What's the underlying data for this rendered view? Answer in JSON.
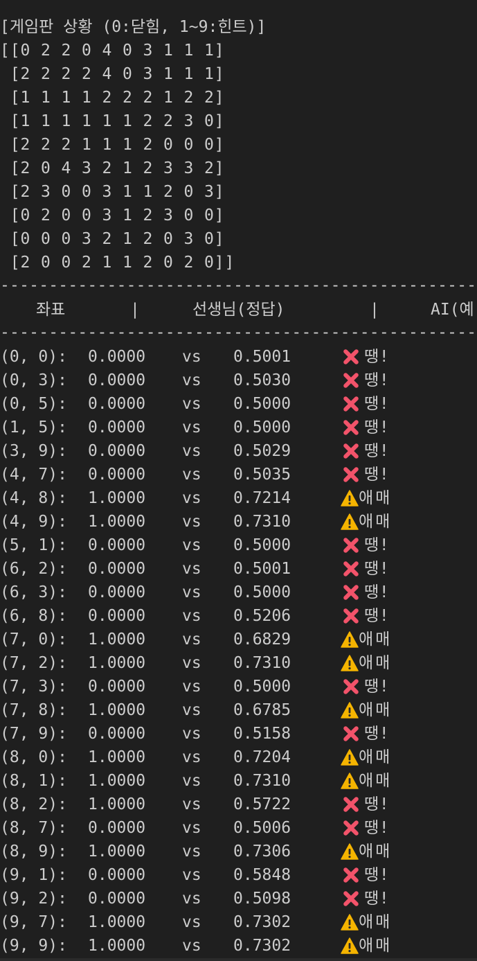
{
  "board_title": "[게임판 상황 (0:닫힘, 1~9:힌트)]",
  "board_rows": [
    "[[0 2 2 0 4 0 3 1 1 1]",
    " [2 2 2 2 4 0 3 1 1 1]",
    " [1 1 1 1 2 2 2 1 2 2]",
    " [1 1 1 1 1 1 2 2 3 0]",
    " [2 2 2 1 1 1 2 0 0 0]",
    " [2 0 4 3 2 1 2 3 3 2]",
    " [2 3 0 0 3 1 1 2 0 3]",
    " [0 2 0 0 3 1 2 3 0 0]",
    " [0 0 0 3 2 1 2 0 3 0]",
    " [2 0 0 2 1 1 2 0 2 0]]"
  ],
  "divider_short": "------------------------------------------------------------",
  "divider_long": "------------------------------------------------------------------------------------------------------",
  "table_header": {
    "coord": "좌표",
    "sep1": "|",
    "teacher": "선생님(정답)",
    "sep2": "|",
    "ai": "AI(예"
  },
  "vs_label": "vs",
  "rows": [
    {
      "coord": "(0, 0):",
      "teacher": "0.0000",
      "ai": "0.5001",
      "icon": "x-icon",
      "result": "땡!"
    },
    {
      "coord": "(0, 3):",
      "teacher": "0.0000",
      "ai": "0.5030",
      "icon": "x-icon",
      "result": "땡!"
    },
    {
      "coord": "(0, 5):",
      "teacher": "0.0000",
      "ai": "0.5000",
      "icon": "x-icon",
      "result": "땡!"
    },
    {
      "coord": "(1, 5):",
      "teacher": "0.0000",
      "ai": "0.5000",
      "icon": "x-icon",
      "result": "땡!"
    },
    {
      "coord": "(3, 9):",
      "teacher": "0.0000",
      "ai": "0.5029",
      "icon": "x-icon",
      "result": "땡!"
    },
    {
      "coord": "(4, 7):",
      "teacher": "0.0000",
      "ai": "0.5035",
      "icon": "x-icon",
      "result": "땡!"
    },
    {
      "coord": "(4, 8):",
      "teacher": "1.0000",
      "ai": "0.7214",
      "icon": "warning-icon",
      "result": "애매"
    },
    {
      "coord": "(4, 9):",
      "teacher": "1.0000",
      "ai": "0.7310",
      "icon": "warning-icon",
      "result": "애매"
    },
    {
      "coord": "(5, 1):",
      "teacher": "0.0000",
      "ai": "0.5000",
      "icon": "x-icon",
      "result": "땡!"
    },
    {
      "coord": "(6, 2):",
      "teacher": "0.0000",
      "ai": "0.5001",
      "icon": "x-icon",
      "result": "땡!"
    },
    {
      "coord": "(6, 3):",
      "teacher": "0.0000",
      "ai": "0.5000",
      "icon": "x-icon",
      "result": "땡!"
    },
    {
      "coord": "(6, 8):",
      "teacher": "0.0000",
      "ai": "0.5206",
      "icon": "x-icon",
      "result": "땡!"
    },
    {
      "coord": "(7, 0):",
      "teacher": "1.0000",
      "ai": "0.6829",
      "icon": "warning-icon",
      "result": "애매"
    },
    {
      "coord": "(7, 2):",
      "teacher": "1.0000",
      "ai": "0.7310",
      "icon": "warning-icon",
      "result": "애매"
    },
    {
      "coord": "(7, 3):",
      "teacher": "0.0000",
      "ai": "0.5000",
      "icon": "x-icon",
      "result": "땡!"
    },
    {
      "coord": "(7, 8):",
      "teacher": "1.0000",
      "ai": "0.6785",
      "icon": "warning-icon",
      "result": "애매"
    },
    {
      "coord": "(7, 9):",
      "teacher": "0.0000",
      "ai": "0.5158",
      "icon": "x-icon",
      "result": "땡!"
    },
    {
      "coord": "(8, 0):",
      "teacher": "1.0000",
      "ai": "0.7204",
      "icon": "warning-icon",
      "result": "애매"
    },
    {
      "coord": "(8, 1):",
      "teacher": "1.0000",
      "ai": "0.7310",
      "icon": "warning-icon",
      "result": "애매"
    },
    {
      "coord": "(8, 2):",
      "teacher": "1.0000",
      "ai": "0.5722",
      "icon": "x-icon",
      "result": "땡!"
    },
    {
      "coord": "(8, 7):",
      "teacher": "0.0000",
      "ai": "0.5006",
      "icon": "x-icon",
      "result": "땡!"
    },
    {
      "coord": "(8, 9):",
      "teacher": "1.0000",
      "ai": "0.7306",
      "icon": "warning-icon",
      "result": "애매"
    },
    {
      "coord": "(9, 1):",
      "teacher": "0.0000",
      "ai": "0.5848",
      "icon": "x-icon",
      "result": "땡!"
    },
    {
      "coord": "(9, 2):",
      "teacher": "0.0000",
      "ai": "0.5098",
      "icon": "x-icon",
      "result": "땡!"
    },
    {
      "coord": "(9, 7):",
      "teacher": "1.0000",
      "ai": "0.7302",
      "icon": "warning-icon",
      "result": "애매"
    },
    {
      "coord": "(9, 9):",
      "teacher": "1.0000",
      "ai": "0.7302",
      "icon": "warning-icon",
      "result": "애매"
    }
  ],
  "colors": {
    "background": "#1f1f1f",
    "text": "#cccccc",
    "error_mark": "#f2536a",
    "warning_mark": "#f5b400"
  }
}
